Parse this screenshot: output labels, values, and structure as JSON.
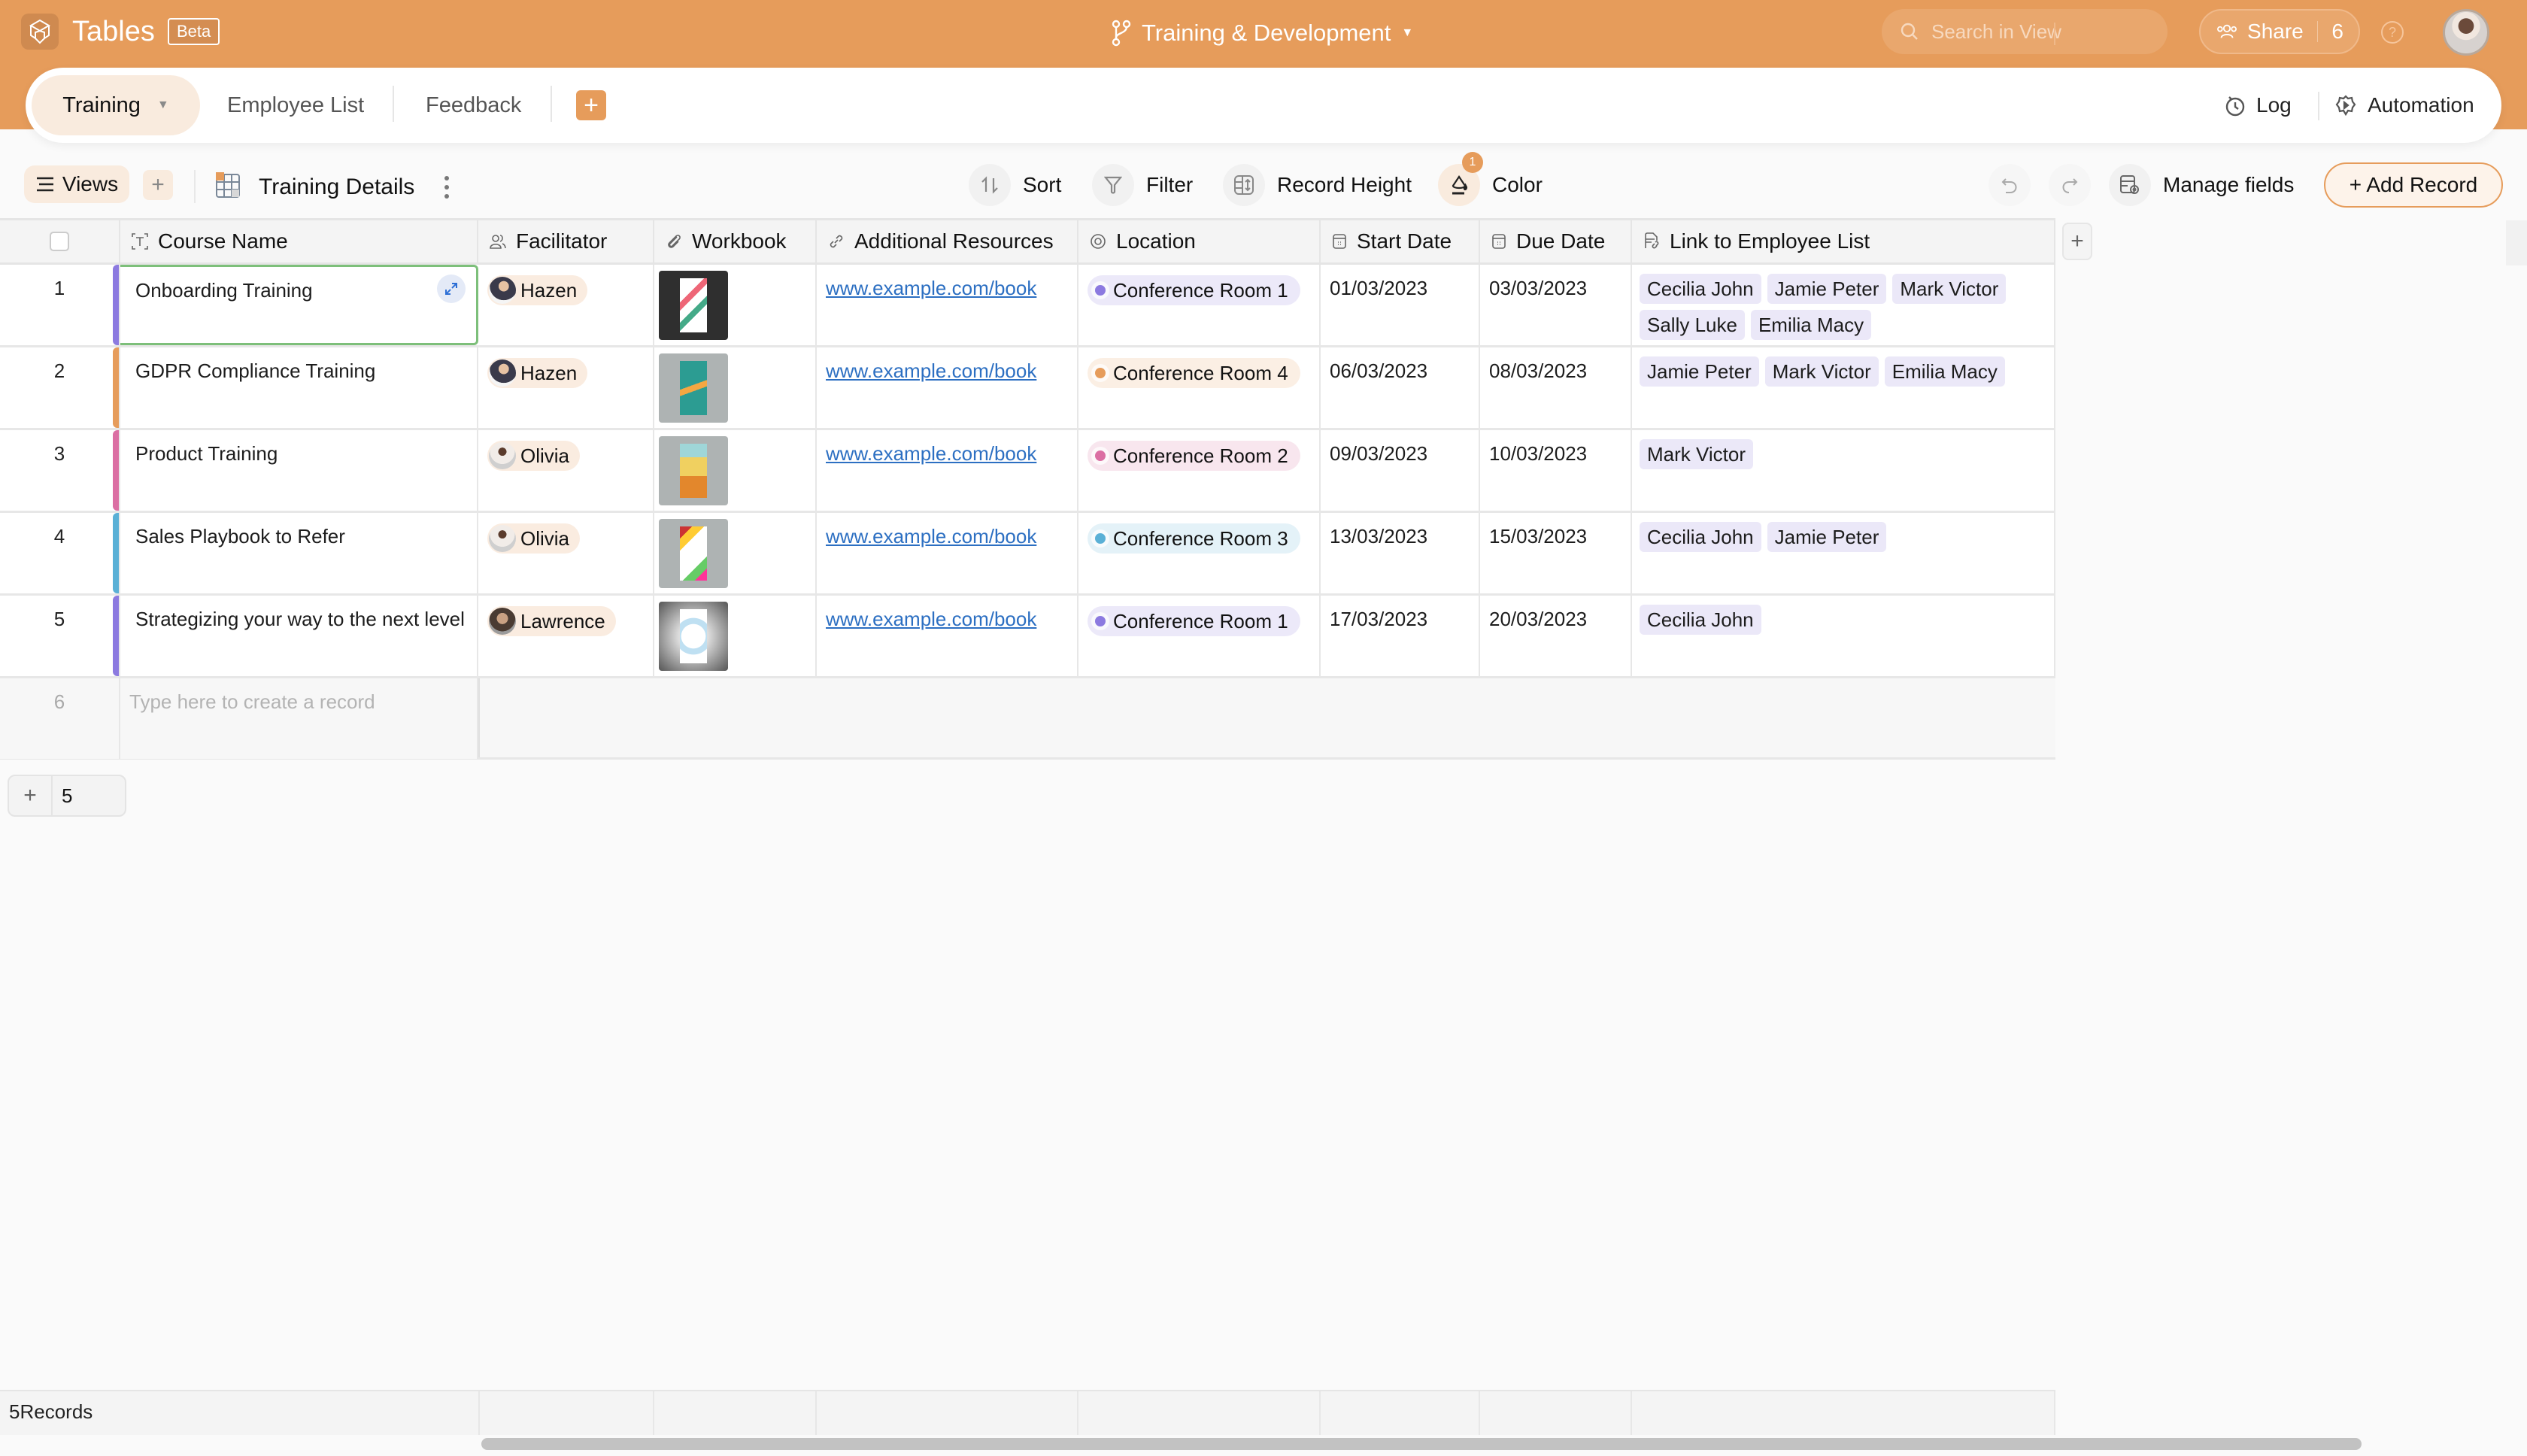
{
  "app": {
    "title": "Tables",
    "beta_label": "Beta",
    "base_name": "Training & Development",
    "search_placeholder": "Search in View",
    "share_label": "Share",
    "share_count": "6",
    "help_label": "?"
  },
  "tabs": [
    {
      "label": "Training",
      "active": true
    },
    {
      "label": "Employee List",
      "active": false
    },
    {
      "label": "Feedback",
      "active": false
    }
  ],
  "tab_actions": {
    "log_label": "Log",
    "automation_label": "Automation",
    "add_tab_label": "+"
  },
  "toolbar": {
    "views_label": "Views",
    "add_view_label": "+",
    "view_name": "Training Details",
    "sort_label": "Sort",
    "filter_label": "Filter",
    "record_height_label": "Record Height",
    "color_label": "Color",
    "color_badge": "1",
    "manage_fields_label": "Manage fields",
    "add_record_label": "+ Add Record"
  },
  "columns": [
    {
      "key": "course",
      "label": "Course Name",
      "icon": "text-field-icon"
    },
    {
      "key": "facilitator",
      "label": "Facilitator",
      "icon": "people-icon"
    },
    {
      "key": "workbook",
      "label": "Workbook",
      "icon": "paperclip-icon"
    },
    {
      "key": "resources",
      "label": "Additional Resources",
      "icon": "link-icon"
    },
    {
      "key": "location",
      "label": "Location",
      "icon": "single-select-icon"
    },
    {
      "key": "start",
      "label": "Start Date",
      "icon": "calendar-icon"
    },
    {
      "key": "due",
      "label": "Due Date",
      "icon": "calendar-icon"
    },
    {
      "key": "employees",
      "label": "Link to Employee List",
      "icon": "linked-record-icon"
    }
  ],
  "rows": [
    {
      "num": "1",
      "course": "Onboarding Training",
      "color": "#8c7ae0",
      "facilitator": "Hazen",
      "avatar": "hazen",
      "workbook": "cover-1",
      "resources": "www.example.com/book",
      "location": "Conference Room 1",
      "loc_color": "#8c7ae0",
      "loc_bg": "#ece9f9",
      "start": "01/03/2023",
      "due": "03/03/2023",
      "employees": [
        "Cecilia John",
        "Jamie Peter",
        "Mark Victor",
        "Sally Luke",
        "Emilia Macy"
      ]
    },
    {
      "num": "2",
      "course": "GDPR Compliance Training",
      "color": "#e69c5b",
      "facilitator": "Hazen",
      "avatar": "hazen",
      "workbook": "cover-2",
      "resources": "www.example.com/book",
      "location": "Conference Room 4",
      "loc_color": "#e69c5b",
      "loc_bg": "#fbefe4",
      "start": "06/03/2023",
      "due": "08/03/2023",
      "employees": [
        "Jamie Peter",
        "Mark Victor",
        "Emilia Macy"
      ]
    },
    {
      "num": "3",
      "course": "Product Training",
      "color": "#db6fa3",
      "facilitator": "Olivia",
      "avatar": "olivia",
      "workbook": "cover-3",
      "resources": "www.example.com/book",
      "location": "Conference Room 2",
      "loc_color": "#db6fa3",
      "loc_bg": "#f8e6ee",
      "start": "09/03/2023",
      "due": "10/03/2023",
      "employees": [
        "Mark Victor"
      ]
    },
    {
      "num": "4",
      "course": "Sales Playbook to Refer",
      "color": "#5ab0d6",
      "facilitator": "Olivia",
      "avatar": "olivia",
      "workbook": "cover-4",
      "resources": "www.example.com/book",
      "location": "Conference Room 3",
      "loc_color": "#5ab0d6",
      "loc_bg": "#e4f2f8",
      "start": "13/03/2023",
      "due": "15/03/2023",
      "employees": [
        "Cecilia John",
        "Jamie Peter"
      ]
    },
    {
      "num": "5",
      "course": "Strategizing your way to the next level",
      "color": "#8c7ae0",
      "facilitator": "Lawrence",
      "avatar": "lawrence",
      "workbook": "cover-5",
      "resources": "www.example.com/book",
      "location": "Conference Room 1",
      "loc_color": "#8c7ae0",
      "loc_bg": "#ece9f9",
      "start": "17/03/2023",
      "due": "20/03/2023",
      "employees": [
        "Cecilia John"
      ]
    }
  ],
  "new_row": {
    "num": "6",
    "placeholder": "Type here to create a record"
  },
  "add_rows_count": "5",
  "footer": {
    "records_label": "5Records"
  },
  "colors": {
    "brand": "#e69c5b",
    "selection": "#7dbf7a",
    "link": "#2c6fc2"
  }
}
